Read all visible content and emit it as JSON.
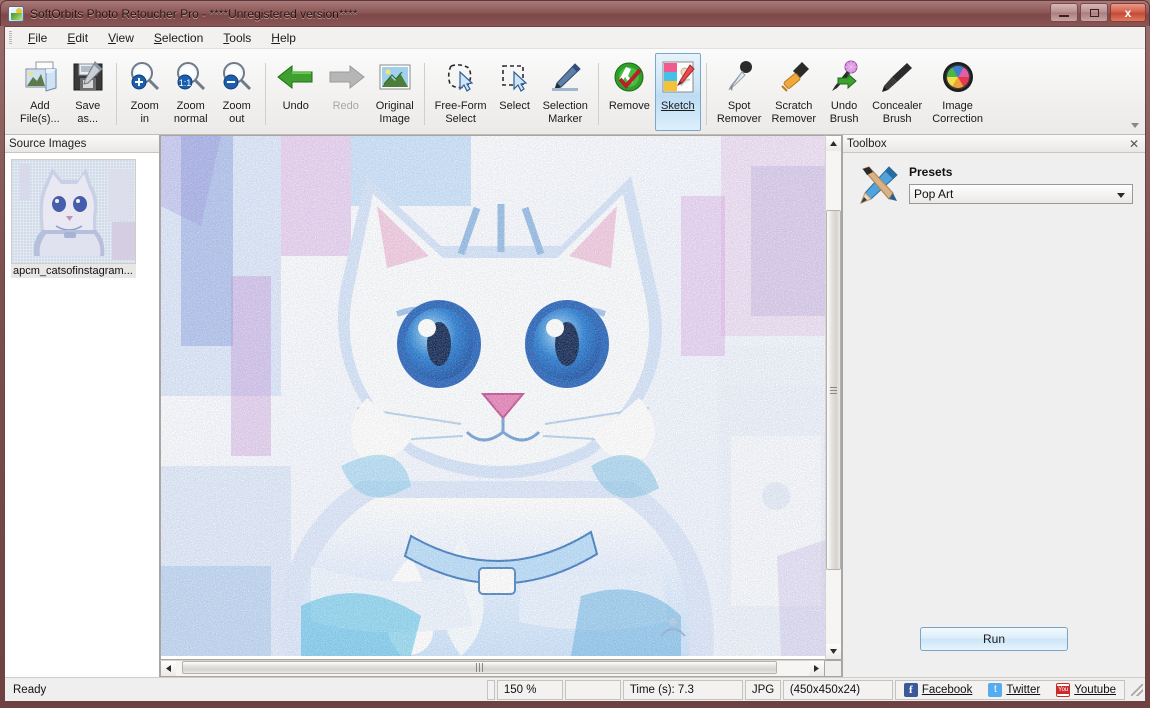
{
  "window": {
    "title": "SoftOrbits Photo Retoucher Pro - ****Unregistered version****",
    "app_icon": "app-icon",
    "minimize_label": "—",
    "maximize_label": "▭",
    "close_label": "x"
  },
  "menu": {
    "items": [
      {
        "label": "File",
        "accel": "F"
      },
      {
        "label": "Edit",
        "accel": "E"
      },
      {
        "label": "View",
        "accel": "V"
      },
      {
        "label": "Selection",
        "accel": "S"
      },
      {
        "label": "Tools",
        "accel": "T"
      },
      {
        "label": "Help",
        "accel": "H"
      }
    ]
  },
  "toolbar": {
    "buttons": [
      {
        "label": "Add\nFile(s)...",
        "icon": "add-files-icon",
        "state": "normal"
      },
      {
        "label": "Save\nas...",
        "icon": "save-as-icon",
        "state": "normal"
      },
      {
        "label": "Zoom\nin",
        "icon": "zoom-in-icon",
        "state": "normal"
      },
      {
        "label": "Zoom\nnormal",
        "icon": "zoom-normal-icon",
        "state": "normal"
      },
      {
        "label": "Zoom\nout",
        "icon": "zoom-out-icon",
        "state": "normal"
      },
      {
        "label": "Undo",
        "icon": "undo-icon",
        "state": "normal"
      },
      {
        "label": "Redo",
        "icon": "redo-icon",
        "state": "disabled"
      },
      {
        "label": "Original\nImage",
        "icon": "original-image-icon",
        "state": "normal"
      },
      {
        "label": "Free-Form\nSelect",
        "icon": "free-form-select-icon",
        "state": "normal"
      },
      {
        "label": "Select",
        "icon": "select-icon",
        "state": "normal"
      },
      {
        "label": "Selection\nMarker",
        "icon": "selection-marker-icon",
        "state": "normal"
      },
      {
        "label": "Remove",
        "icon": "remove-icon",
        "state": "normal"
      },
      {
        "label": "Sketch",
        "icon": "sketch-icon",
        "state": "active"
      },
      {
        "label": "Spot\nRemover",
        "icon": "spot-remover-icon",
        "state": "normal"
      },
      {
        "label": "Scratch\nRemover",
        "icon": "scratch-remover-icon",
        "state": "normal"
      },
      {
        "label": "Undo\nBrush",
        "icon": "undo-brush-icon",
        "state": "normal"
      },
      {
        "label": "Concealer\nBrush",
        "icon": "concealer-brush-icon",
        "state": "normal"
      },
      {
        "label": "Image\nCorrection",
        "icon": "image-correction-icon",
        "state": "normal"
      }
    ]
  },
  "source_panel": {
    "title": "Source Images",
    "thumbnail_label": "apcm_catsofinstagram..."
  },
  "toolbox": {
    "title": "Toolbox",
    "close_label": "✕",
    "icon": "pencil-brush-icon",
    "presets_label": "Presets",
    "preset_value": "Pop Art",
    "run_label": "Run"
  },
  "canvas": {
    "zoom_level": "150 %",
    "vscroll_up": "▲",
    "vscroll_down": "▼",
    "hscroll_left": "◄",
    "hscroll_right": "►"
  },
  "status": {
    "ready": "Ready",
    "zoom": "150 %",
    "empty": "",
    "time": "Time (s): 7.3",
    "format": "JPG",
    "dimensions": "(450x450x24)",
    "social": [
      {
        "label": "Facebook",
        "icon": "facebook-icon"
      },
      {
        "label": "Twitter",
        "icon": "twitter-icon"
      },
      {
        "label": "Youtube",
        "icon": "youtube-icon"
      }
    ]
  },
  "colors": {
    "accent": "#7aa8cc",
    "titlebar": "#8d5757",
    "close_button": "#d4604c",
    "panel": "#f0efef"
  }
}
